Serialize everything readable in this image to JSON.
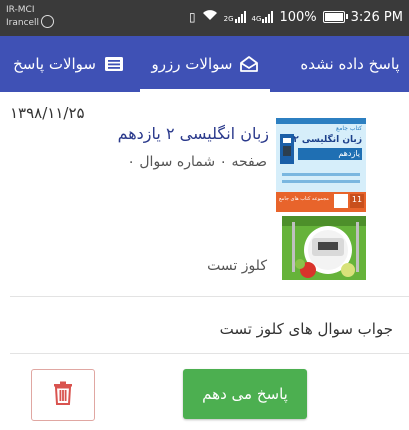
{
  "status_bar": {
    "carrier_1": "IR-MCI",
    "carrier_2": "Irancell",
    "network_1": "2G",
    "network_2": "4G",
    "battery": "100%",
    "time": "3:26 PM"
  },
  "tabs": [
    {
      "label": "پاسخ داده نشده"
    },
    {
      "label": "سوالات رزرو",
      "active": true
    },
    {
      "label": "سوالات پاسخ"
    }
  ],
  "card": {
    "date": "۱۳۹۸/۱۱/۲۵",
    "book_title": "زبان انگلیسی ۲ یازدهم",
    "book_meta": "صفحه ۰ شماره سوال ۰",
    "question_label": "کلوز تست",
    "description": "جواب سوال های کلوز تست",
    "answer_button": "پاسخ می دهم"
  },
  "book_cover": {
    "header": "کتاب جامع",
    "title": "زبان انگلیسی ۲",
    "subtitle": "یازدهم",
    "footer": "مجموعه کتاب های جامع",
    "badge": "11"
  },
  "colors": {
    "primary": "#3f51b5",
    "status_bar": "#3a3a3a",
    "answer_green": "#4caf50",
    "delete_red": "#d9534f",
    "title_blue": "#2b3a8c"
  }
}
